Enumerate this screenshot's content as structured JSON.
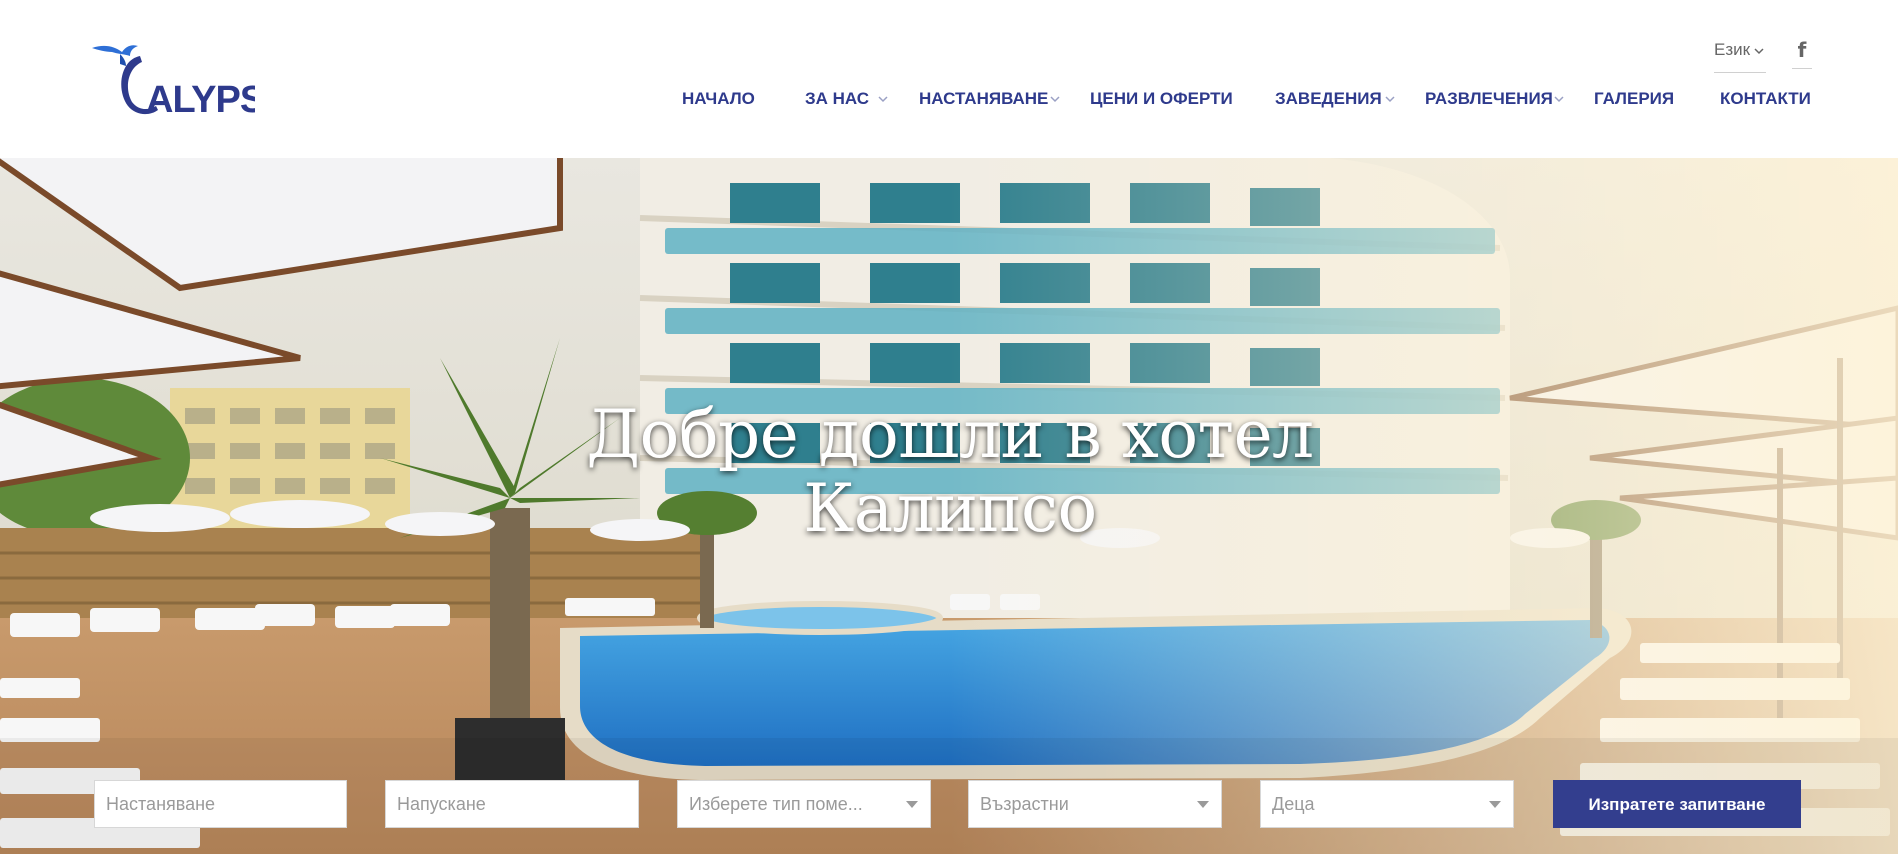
{
  "brand": {
    "logo_text": "ALYPSO",
    "logo_initial": "C",
    "color": "#2e3a8c",
    "bird_color": "#2e6fd6"
  },
  "header": {
    "language_label": "Език",
    "social": {
      "facebook_icon": "f"
    },
    "nav": [
      {
        "label": "НАЧАЛО",
        "has_dropdown": false
      },
      {
        "label": "ЗА НАС",
        "has_dropdown": true
      },
      {
        "label": "НАСТАНЯВАНЕ",
        "has_dropdown": true
      },
      {
        "label": "ЦЕНИ И ОФЕРТИ",
        "has_dropdown": false
      },
      {
        "label": "ЗАВЕДЕНИЯ",
        "has_dropdown": true
      },
      {
        "label": "РАЗВЛЕЧЕНИЯ",
        "has_dropdown": true
      },
      {
        "label": "ГАЛЕРИЯ",
        "has_dropdown": false
      },
      {
        "label": "КОНТАКТИ",
        "has_dropdown": false
      }
    ]
  },
  "hero": {
    "title_line1": "Добре дошли в хотел",
    "title_line2": "Калипсо"
  },
  "booking": {
    "checkin_placeholder": "Настаняване",
    "checkout_placeholder": "Напускане",
    "room_type_value": "Изберете тип поме...",
    "adults_value": "Възрастни",
    "children_value": "Деца",
    "submit_label": "Изпратете запитване",
    "button_color": "#333e8e"
  }
}
